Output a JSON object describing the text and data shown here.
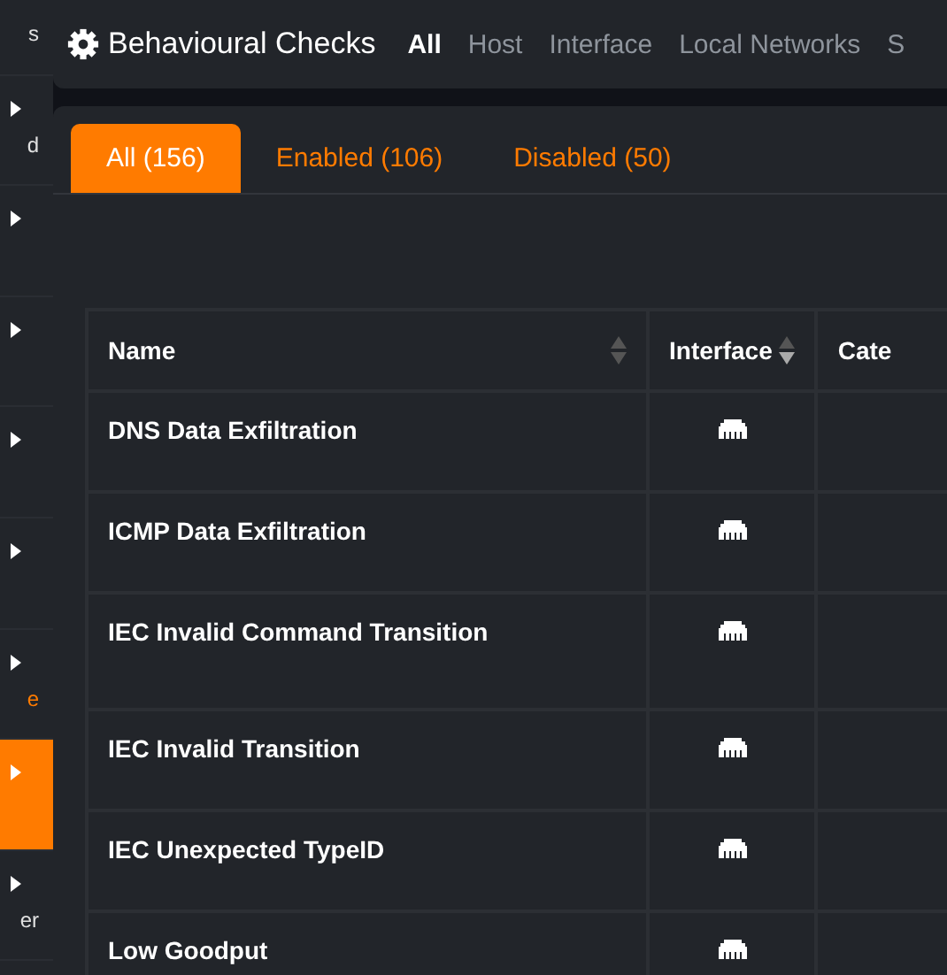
{
  "sidebar": {
    "items": [
      {
        "label": "s",
        "arrow": false,
        "selected": false
      },
      {
        "label": "d",
        "arrow": true,
        "selected": false
      },
      {
        "arrow": true,
        "selected": false
      },
      {
        "arrow": true,
        "selected": false
      },
      {
        "arrow": true,
        "selected": false
      },
      {
        "arrow": true,
        "selected": false
      },
      {
        "label": "e",
        "arrow": true,
        "selected": false,
        "color": "#ff7b00"
      },
      {
        "arrow": true,
        "selected": true
      },
      {
        "label": "er",
        "arrow": true,
        "selected": false
      }
    ]
  },
  "header": {
    "title": "Behavioural Checks",
    "filters": [
      {
        "label": "All",
        "selected": true
      },
      {
        "label": "Host",
        "selected": false
      },
      {
        "label": "Interface",
        "selected": false
      },
      {
        "label": "Local Networks",
        "selected": false
      },
      {
        "label": "S",
        "selected": false
      }
    ]
  },
  "tabs": [
    {
      "label": "All (156)",
      "selected": true
    },
    {
      "label": "Enabled (106)",
      "selected": false
    },
    {
      "label": "Disabled (50)",
      "selected": false
    }
  ],
  "table": {
    "columns": [
      {
        "label": "Name",
        "sort_desc": false
      },
      {
        "label": "Interface",
        "sort_desc": true
      },
      {
        "label": "Cate"
      }
    ],
    "rows": [
      {
        "name": "DNS Data Exfiltration"
      },
      {
        "name": "ICMP Data Exfiltration"
      },
      {
        "name": "IEC Invalid Command Transition"
      },
      {
        "name": "IEC Invalid Transition"
      },
      {
        "name": "IEC Unexpected TypeID"
      },
      {
        "name": "Low Goodput"
      }
    ]
  }
}
